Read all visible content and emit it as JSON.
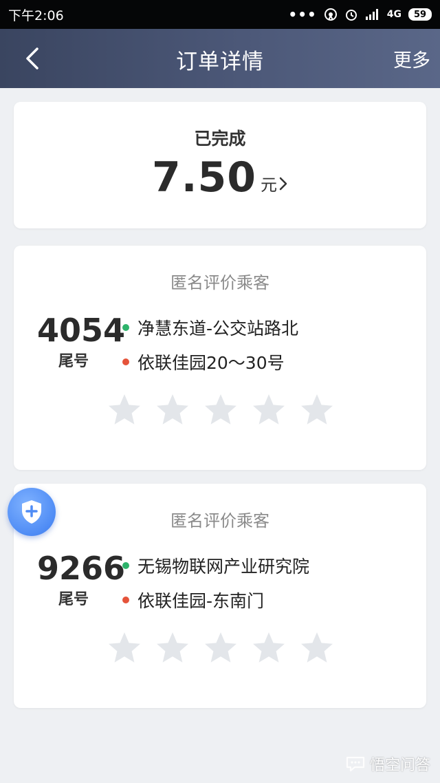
{
  "status_bar": {
    "time": "下午2:06",
    "network": "4G",
    "battery": "59"
  },
  "header": {
    "title": "订单详情",
    "more_label": "更多"
  },
  "order": {
    "status": "已完成",
    "fare_amount": "7.50",
    "fare_unit": "元"
  },
  "trips": [
    {
      "heading": "匿名评价乘客",
      "tail_number": "4054",
      "tail_label": "尾号",
      "pickup": "净慧东道-公交站路北",
      "dropoff": "依联佳园20～30号",
      "rating": 0,
      "max_rating": 5
    },
    {
      "heading": "匿名评价乘客",
      "tail_number": "9266",
      "tail_label": "尾号",
      "pickup": "无锡物联网产业研究院",
      "dropoff": "依联佳园-东南门",
      "rating": 0,
      "max_rating": 5
    }
  ],
  "watermark": "悟空问答",
  "colors": {
    "header_start": "#3a4560",
    "header_end": "#5a6788",
    "pickup_dot": "#2db36b",
    "dropoff_dot": "#e5533a",
    "star_empty": "#e3e6ea",
    "safety_button": "#4f8cf5"
  }
}
